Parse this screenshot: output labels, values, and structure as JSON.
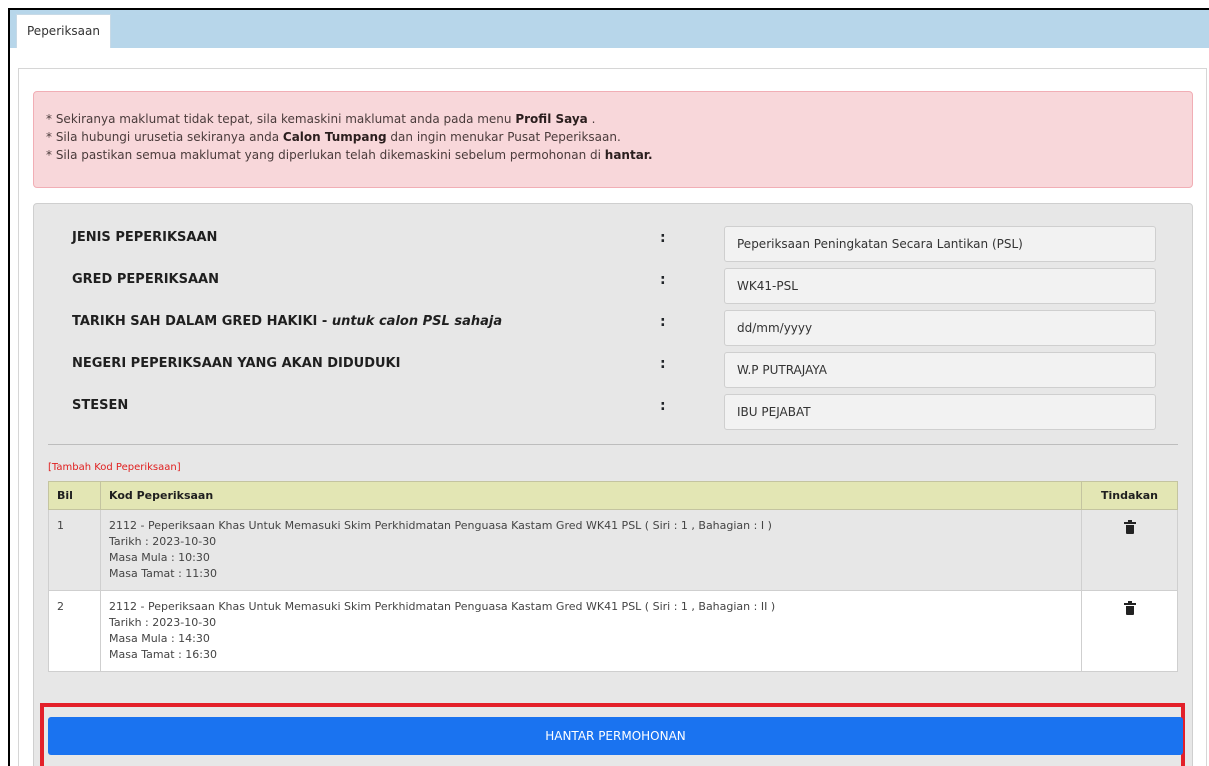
{
  "tab": {
    "label": "Peperiksaan"
  },
  "alert": {
    "line1_pre": "* Sekiranya maklumat tidak tepat, sila kemaskini maklumat anda pada menu ",
    "line1_bold": "Profil Saya",
    "line1_post": " .",
    "line2_pre": "* Sila hubungi urusetia sekiranya anda ",
    "line2_bold": "Calon Tumpang",
    "line2_post": " dan ingin menukar Pusat Peperiksaan.",
    "line3_pre": "* Sila pastikan semua maklumat yang diperlukan telah dikemaskini sebelum permohonan di ",
    "line3_bold": "hantar."
  },
  "fields": {
    "jenis": {
      "label": "JENIS PEPERIKSAAN",
      "value": "Peperiksaan Peningkatan Secara Lantikan (PSL)"
    },
    "gred": {
      "label": "GRED PEPERIKSAAN",
      "value": "WK41-PSL"
    },
    "tarikh": {
      "label": "TARIKH SAH DALAM GRED HAKIKI - ",
      "label_italic": "untuk calon PSL sahaja",
      "placeholder": "dd/mm/yyyy"
    },
    "negeri": {
      "label": "NEGERI PEPERIKSAAN YANG AKAN DIDUDUKI",
      "value": "W.P PUTRAJAYA"
    },
    "stesen": {
      "label": "STESEN",
      "value": "IBU PEJABAT"
    },
    "colon": ":"
  },
  "add_link": "[Tambah Kod Peperiksaan]",
  "table": {
    "headers": {
      "bil": "Bil",
      "kod": "Kod Peperiksaan",
      "tindakan": "Tindakan"
    },
    "rows": [
      {
        "bil": "1",
        "title": "2112 - Peperiksaan Khas Untuk Memasuki Skim Perkhidmatan Penguasa Kastam Gred WK41 PSL ( Siri : 1 , Bahagian : I )",
        "tarikh": "Tarikh : 2023-10-30",
        "mula": "Masa Mula : 10:30",
        "tamat": "Masa Tamat : 11:30"
      },
      {
        "bil": "2",
        "title": "2112 - Peperiksaan Khas Untuk Memasuki Skim Perkhidmatan Penguasa Kastam Gred WK41 PSL ( Siri : 1 , Bahagian : II )",
        "tarikh": "Tarikh : 2023-10-30",
        "mula": "Masa Mula : 14:30",
        "tamat": "Masa Tamat : 16:30"
      }
    ]
  },
  "submit_label": "HANTAR PERMOHONAN",
  "colors": {
    "tabbar": "#b7d6ea",
    "alert_bg": "#f8d7da",
    "header_bg": "#e3e6b4",
    "button": "#1a73f0",
    "highlight": "#e3202a"
  }
}
